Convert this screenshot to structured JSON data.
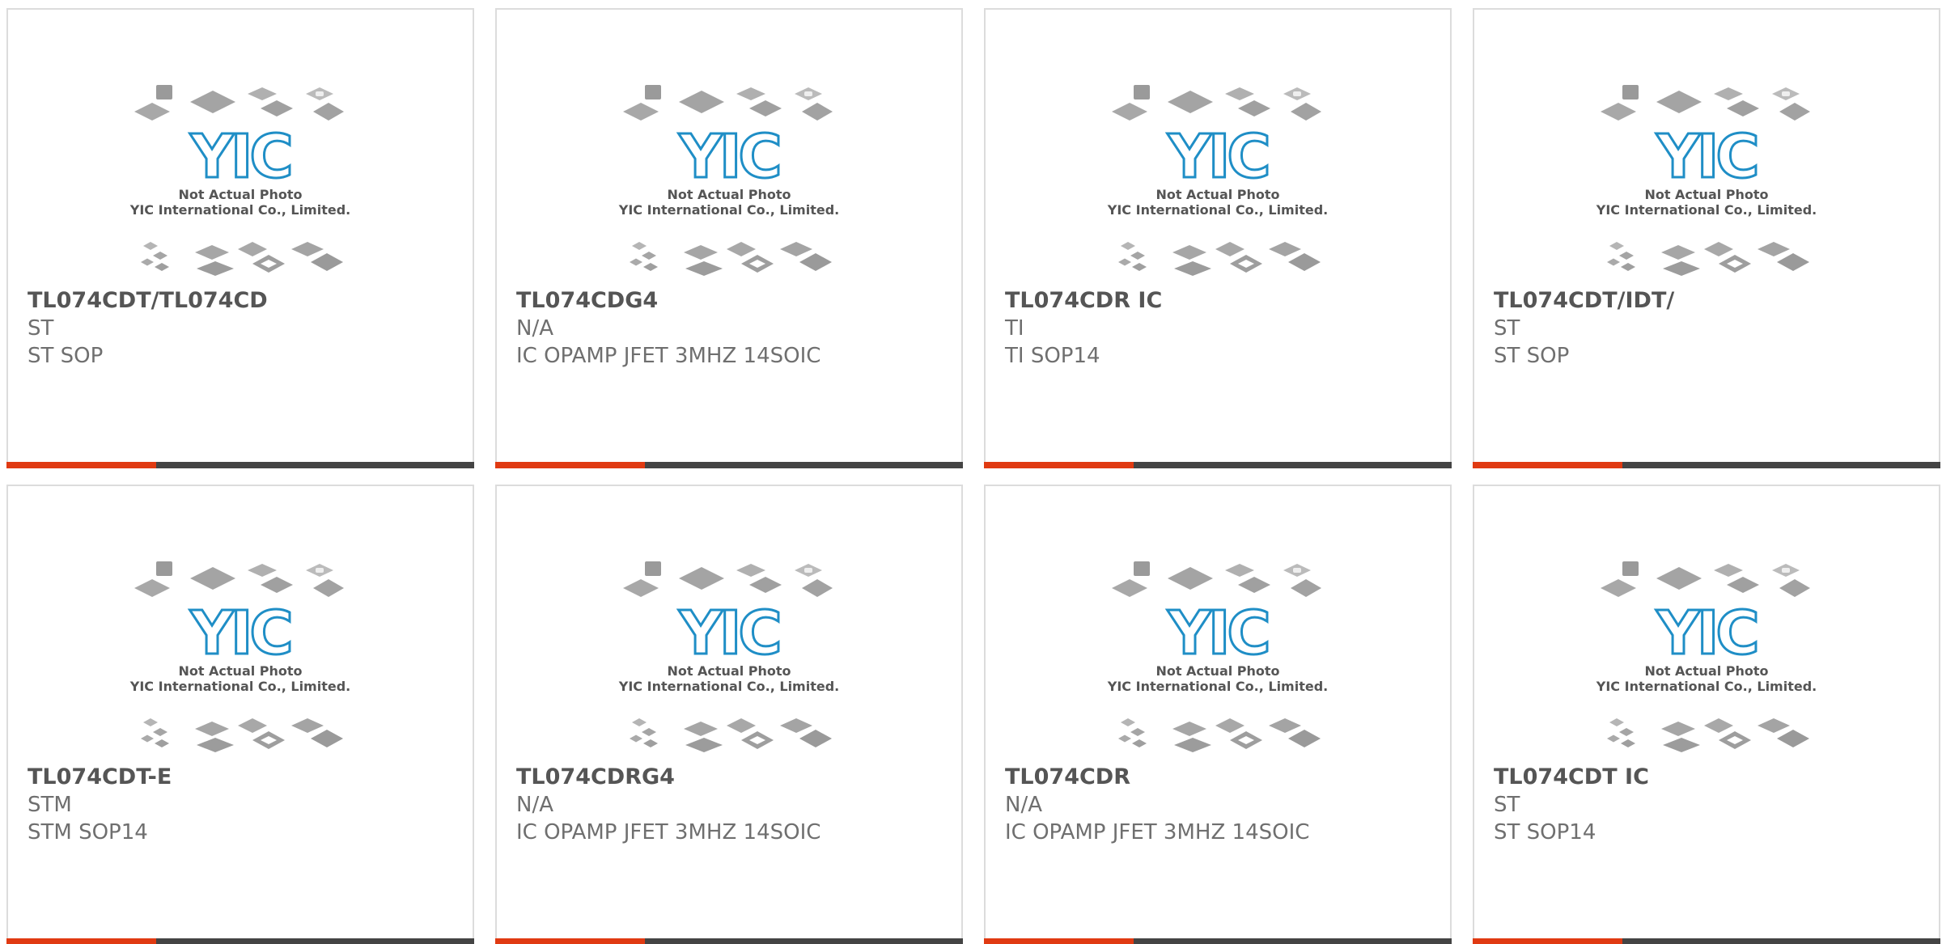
{
  "placeholder": {
    "brand": "YIC",
    "line1": "Not Actual Photo",
    "line2": "YIC International Co., Limited."
  },
  "colors": {
    "accent": "#e03a12",
    "bar": "#444444",
    "logo": "#1f8ec6",
    "border": "#dcdcdc"
  },
  "products": [
    {
      "part": "TL074CDT/TL074CD",
      "manufacturer": "ST",
      "description": "ST SOP"
    },
    {
      "part": "TL074CDG4",
      "manufacturer": "N/A",
      "description": "IC OPAMP JFET 3MHZ 14SOIC"
    },
    {
      "part": "TL074CDR IC",
      "manufacturer": "TI",
      "description": "TI SOP14"
    },
    {
      "part": "TL074CDT/IDT/",
      "manufacturer": "ST",
      "description": "ST SOP"
    },
    {
      "part": "TL074CDT-E",
      "manufacturer": "STM",
      "description": "STM SOP14"
    },
    {
      "part": "TL074CDRG4",
      "manufacturer": "N/A",
      "description": "IC OPAMP JFET 3MHZ 14SOIC"
    },
    {
      "part": "TL074CDR",
      "manufacturer": "N/A",
      "description": "IC OPAMP JFET 3MHZ 14SOIC"
    },
    {
      "part": "TL074CDT IC",
      "manufacturer": "ST",
      "description": "ST SOP14"
    }
  ]
}
